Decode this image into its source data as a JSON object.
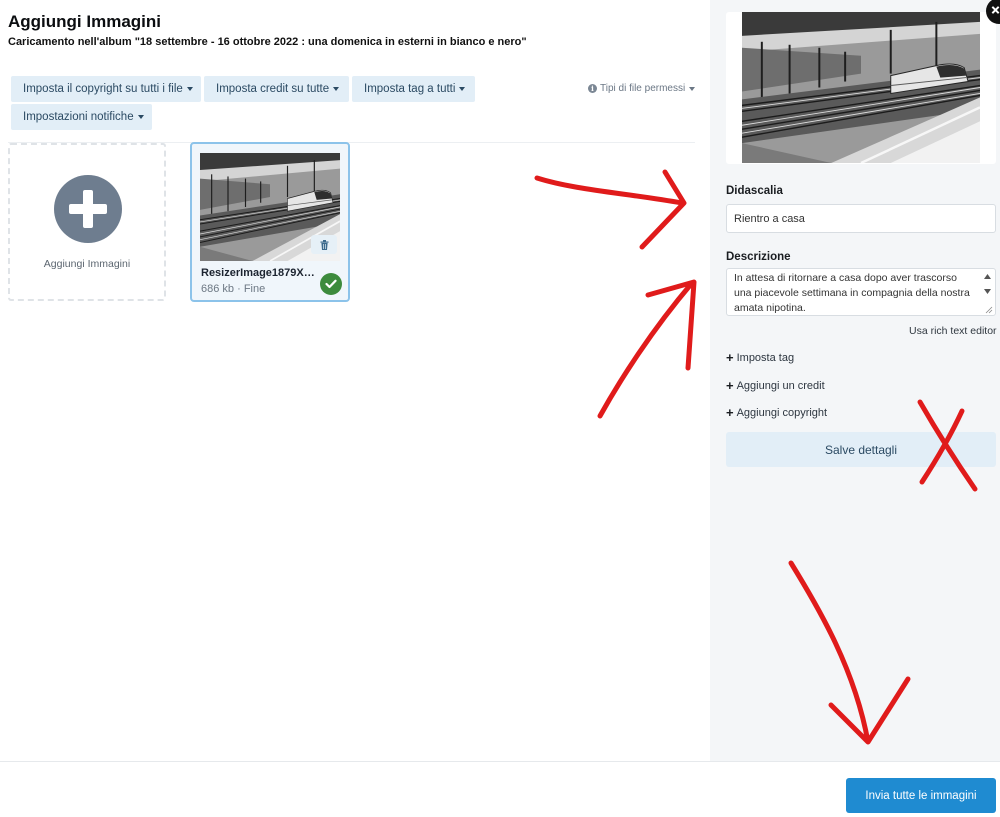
{
  "header": {
    "title": "Aggiungi Immagini",
    "subtitle": "Caricamento nell'album \"18 settembre - 16 ottobre 2022 : una domenica in esterni in bianco e nero\""
  },
  "toolbar": {
    "copyright_all": "Imposta il copyright su tutti i file",
    "credit_all": "Imposta credit su tutte",
    "tag_all": "Imposta tag a tutti",
    "notifications": "Impostazioni notifiche",
    "file_types": "Tipi di file permessi"
  },
  "add_tile": {
    "label": "Aggiungi Immagini",
    "icon": "plus-circle-icon"
  },
  "file": {
    "name": "ResizerImage1879X1...",
    "size": "686 kb",
    "status": "Fine",
    "status_icon": "check-circle-icon",
    "delete_icon": "trash-icon"
  },
  "details": {
    "caption_label": "Didascalia",
    "caption_value": "Rientro a casa",
    "description_label": "Descrizione",
    "description_value": "In attesa di ritornare a casa dopo aver trascorso una piacevole settimana in compagnia della nostra amata nipotina.",
    "rich_text_link": "Usa rich text editor",
    "set_tag": "Imposta tag",
    "add_credit": "Aggiungi un credit",
    "add_copyright": "Aggiungi copyright",
    "save_button": "Salve dettagli"
  },
  "footer": {
    "submit_button": "Invia tutte le immagini"
  },
  "colors": {
    "accent": "#1f8bd1",
    "secondary_button": "#e2eef7",
    "success": "#3d8b3d",
    "annotation_red": "#e01b1b",
    "side_panel": "#f4f6f8"
  }
}
